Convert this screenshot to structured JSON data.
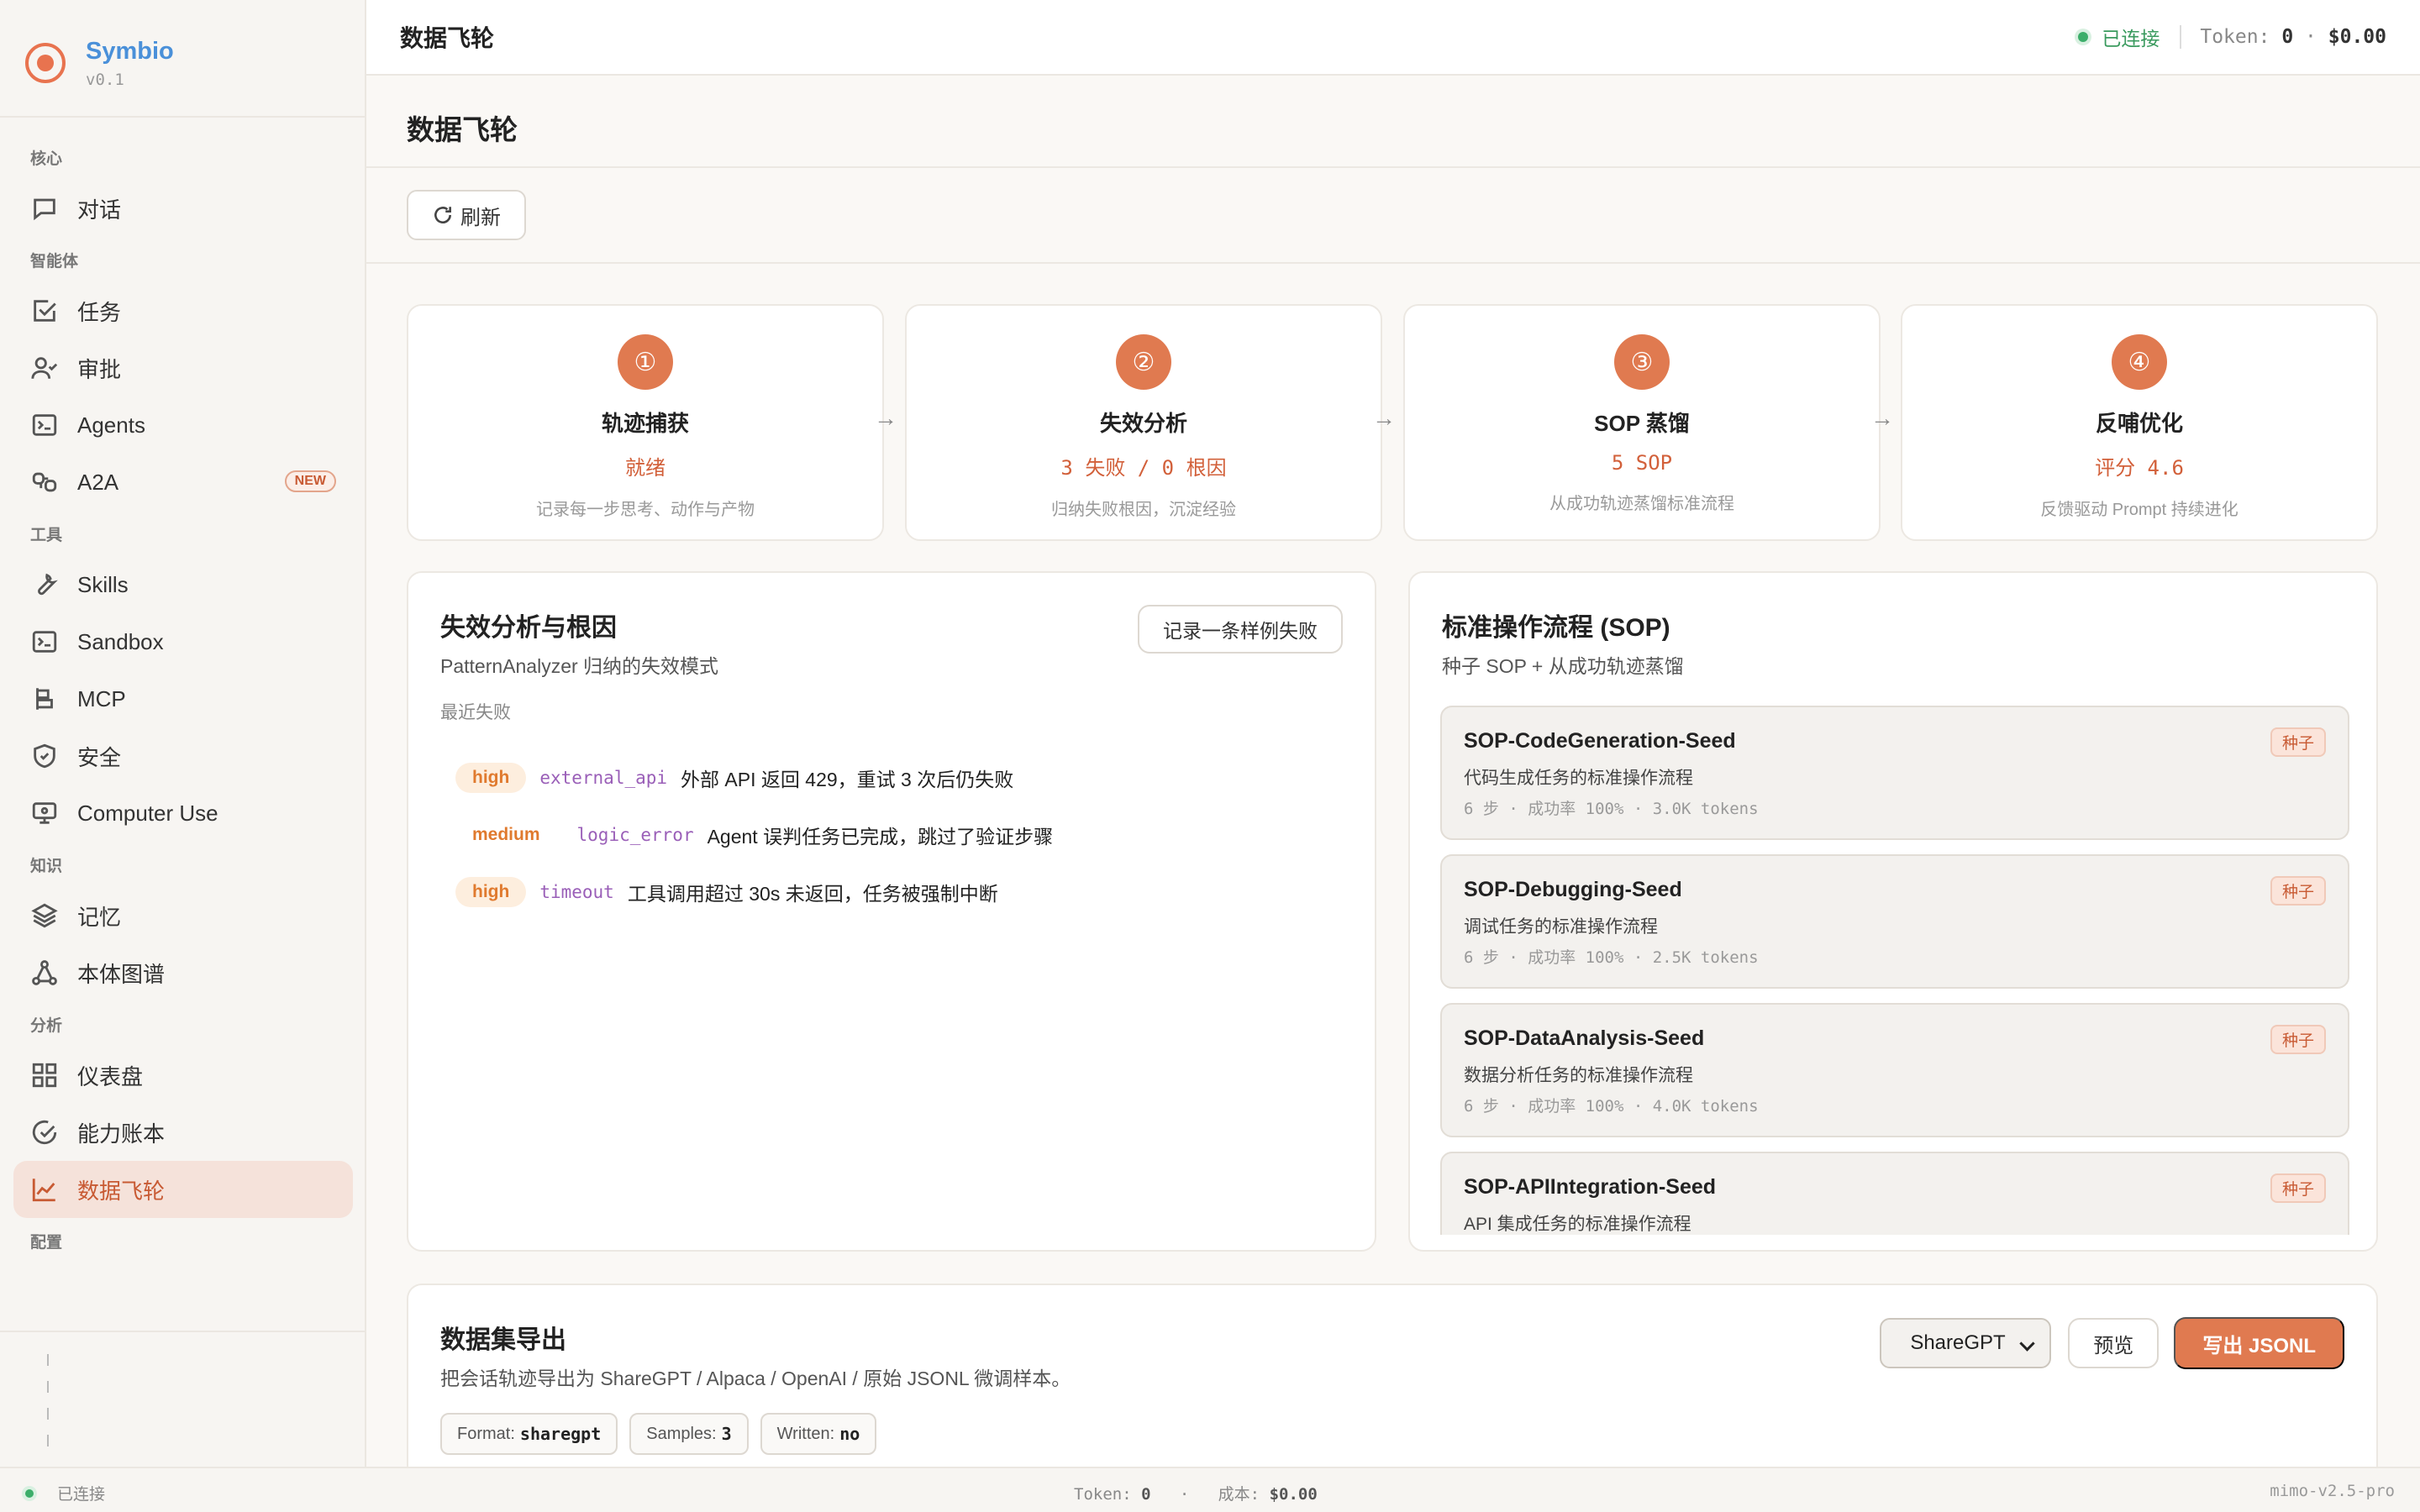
{
  "brand": {
    "name": "Symbio",
    "version": "v0.1"
  },
  "sidebar": {
    "sections": [
      {
        "label": "核心",
        "items": [
          {
            "label": "对话",
            "icon": "chat-icon"
          }
        ]
      },
      {
        "label": "智能体",
        "items": [
          {
            "label": "任务",
            "icon": "checkbox-icon"
          },
          {
            "label": "审批",
            "icon": "user-check-icon"
          },
          {
            "label": "Agents",
            "icon": "terminal-icon"
          },
          {
            "label": "A2A",
            "icon": "network-icon",
            "badge": "NEW"
          }
        ]
      },
      {
        "label": "工具",
        "items": [
          {
            "label": "Skills",
            "icon": "wrench-icon"
          },
          {
            "label": "Sandbox",
            "icon": "terminal-icon"
          },
          {
            "label": "MCP",
            "icon": "plug-icon"
          },
          {
            "label": "安全",
            "icon": "shield-icon"
          },
          {
            "label": "Computer Use",
            "icon": "monitor-icon"
          }
        ]
      },
      {
        "label": "知识",
        "items": [
          {
            "label": "记忆",
            "icon": "layers-icon"
          },
          {
            "label": "本体图谱",
            "icon": "graph-icon"
          }
        ]
      },
      {
        "label": "分析",
        "items": [
          {
            "label": "仪表盘",
            "icon": "grid-icon"
          },
          {
            "label": "能力账本",
            "icon": "gauge-icon"
          },
          {
            "label": "数据飞轮",
            "icon": "chart-line-icon",
            "active": true
          }
        ]
      },
      {
        "label": "配置",
        "items": []
      }
    ]
  },
  "topbar": {
    "title": "数据飞轮",
    "status": "已连接",
    "token_label": "Token:",
    "token_value": "0",
    "cost_sep": "·",
    "cost_value": "$0.00"
  },
  "page": {
    "title": "数据飞轮",
    "refresh_label": "刷新"
  },
  "steps": [
    {
      "num": "①",
      "title": "轨迹捕获",
      "status": "就绪",
      "desc": "记录每一步思考、动作与产物"
    },
    {
      "num": "②",
      "title": "失效分析",
      "status": "3 失败 / 0 根因",
      "desc": "归纳失败根因，沉淀经验"
    },
    {
      "num": "③",
      "title": "SOP 蒸馏",
      "status": "5 SOP",
      "desc": "从成功轨迹蒸馏标准流程"
    },
    {
      "num": "④",
      "title": "反哺优化",
      "status": "评分 4.6",
      "desc": "反馈驱动 Prompt 持续进化"
    }
  ],
  "arrow": "→",
  "failures": {
    "title": "失效分析与根因",
    "subtitle": "PatternAnalyzer 归纳的失效模式",
    "record_button": "记录一条样例失败",
    "recent_label": "最近失败",
    "items": [
      {
        "severity": "high",
        "category": "external_api",
        "message": "外部 API 返回 429，重试 3 次后仍失败"
      },
      {
        "severity": "medium",
        "category": "logic_error",
        "message": "Agent 误判任务已完成，跳过了验证步骤"
      },
      {
        "severity": "high",
        "category": "timeout",
        "message": "工具调用超过 30s 未返回，任务被强制中断"
      }
    ]
  },
  "sop": {
    "title": "标准操作流程 (SOP)",
    "subtitle": "种子 SOP + 从成功轨迹蒸馏",
    "items": [
      {
        "name": "SOP-CodeGeneration-Seed",
        "desc": "代码生成任务的标准操作流程",
        "meta": "6 步 · 成功率 100% · 3.0K tokens",
        "tag": "种子"
      },
      {
        "name": "SOP-Debugging-Seed",
        "desc": "调试任务的标准操作流程",
        "meta": "6 步 · 成功率 100% · 2.5K tokens",
        "tag": "种子"
      },
      {
        "name": "SOP-DataAnalysis-Seed",
        "desc": "数据分析任务的标准操作流程",
        "meta": "6 步 · 成功率 100% · 4.0K tokens",
        "tag": "种子"
      },
      {
        "name": "SOP-APIIntegration-Seed",
        "desc": "API 集成任务的标准操作流程",
        "meta": "",
        "tag": "种子"
      }
    ]
  },
  "export": {
    "title": "数据集导出",
    "subtitle": "把会话轨迹导出为 ShareGPT / Alpaca / OpenAI / 原始 JSONL 微调样本。",
    "format_selected": "ShareGPT",
    "preview_button": "预览",
    "export_button": "写出 JSONL",
    "chips": [
      {
        "label": "Format:",
        "value": "sharegpt"
      },
      {
        "label": "Samples:",
        "value": "3"
      },
      {
        "label": "Written:",
        "value": "no"
      }
    ]
  },
  "statusbar": {
    "status": "已连接",
    "token_label": "Token:",
    "token_value": "0",
    "sep": "·",
    "cost_label": "成本:",
    "cost_value": "$0.00",
    "model": "mimo-v2.5-pro"
  },
  "colors": {
    "accent": "#e07a50",
    "accent_text": "#c85a33",
    "connected": "#3cae6a",
    "category": "#9a5fb8"
  }
}
